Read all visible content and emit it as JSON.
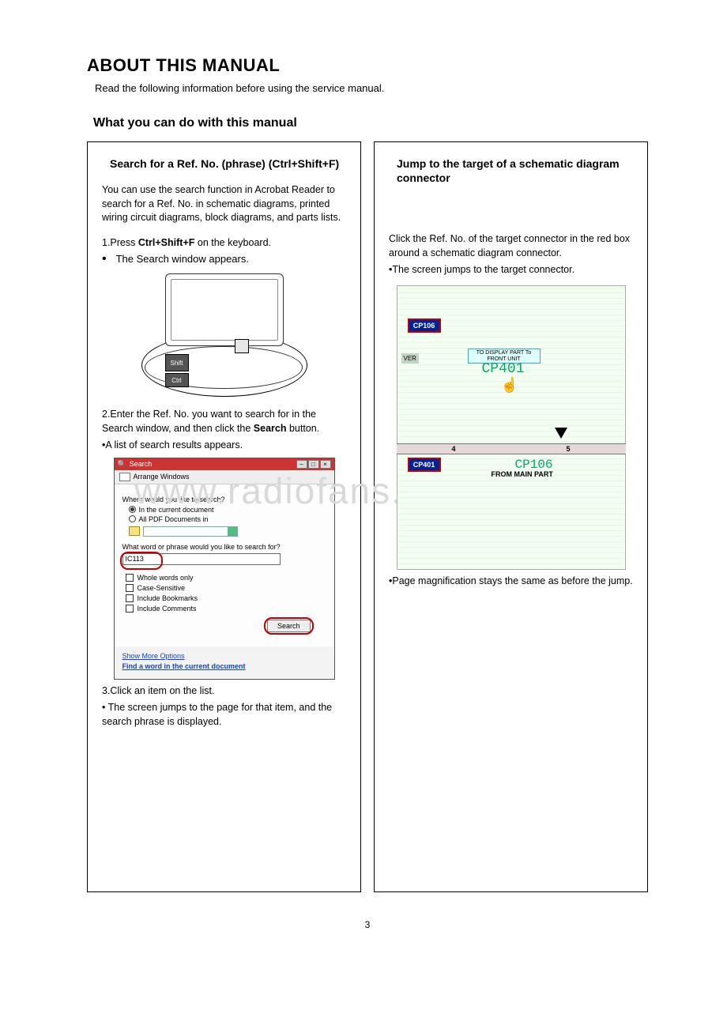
{
  "title": "ABOUT THIS MANUAL",
  "intro": "Read the following information before using the service manual.",
  "subtitle": "What you can do with this manual",
  "left": {
    "heading": "Search for a Ref. No. (phrase) (Ctrl+Shift+F)",
    "desc": "You can use the search function in Acrobat Reader to search for a Ref. No. in schematic diagrams, printed wiring circuit diagrams, block diagrams, and parts lists.",
    "step1_prefix": "1.Press ",
    "step1_kbd": "Ctrl+Shift+F",
    "step1_suffix": " on the keyboard.",
    "step1_result": "The Search window appears.",
    "laptop": {
      "shift": "Shift",
      "ctrl": "Ctrl"
    },
    "step2_prefix": "2.Enter the Ref. No. you want to search for in the Search window, and then click the ",
    "step2_bold": "Search",
    "step2_suffix": " button.",
    "step2_result": "•A list of search results appears.",
    "search_dialog": {
      "title": "Search",
      "arrange": "Arrange Windows",
      "where": "Where would you like to search?",
      "opt_current": "In the current document",
      "opt_all": "All PDF Documents in",
      "what": "What word or phrase would you like to search for?",
      "input": "IC113",
      "whole": "Whole words only",
      "case": "Case-Sensitive",
      "bookmarks": "Include Bookmarks",
      "comments": "Include Comments",
      "button": "Search",
      "link1": "Show More Options",
      "link2": "Find a word in the current document"
    },
    "step3": "3.Click an item on the list.",
    "step3_result": "• The screen jumps to the page for that item, and the search phrase is displayed."
  },
  "right": {
    "heading": "Jump to the target of a schematic diagram connector",
    "desc": "Click the Ref. No. of the target connector in the red box around a schematic diagram connector.",
    "result": "•The screen jumps to the target connector.",
    "figure": {
      "cp106": "CP106",
      "ver": "VER",
      "to_display": "TO DISPLAY PART To FRONT UNIT",
      "cp401": "CP401",
      "num4": "4",
      "num5": "5",
      "cp401_b": "CP401",
      "cp106_b": "CP106",
      "from_main": "FROM MAIN PART"
    },
    "note": "•Page magnification stays the same as before the jump."
  },
  "page_number": "3",
  "watermark": "www.radiofans.cn"
}
